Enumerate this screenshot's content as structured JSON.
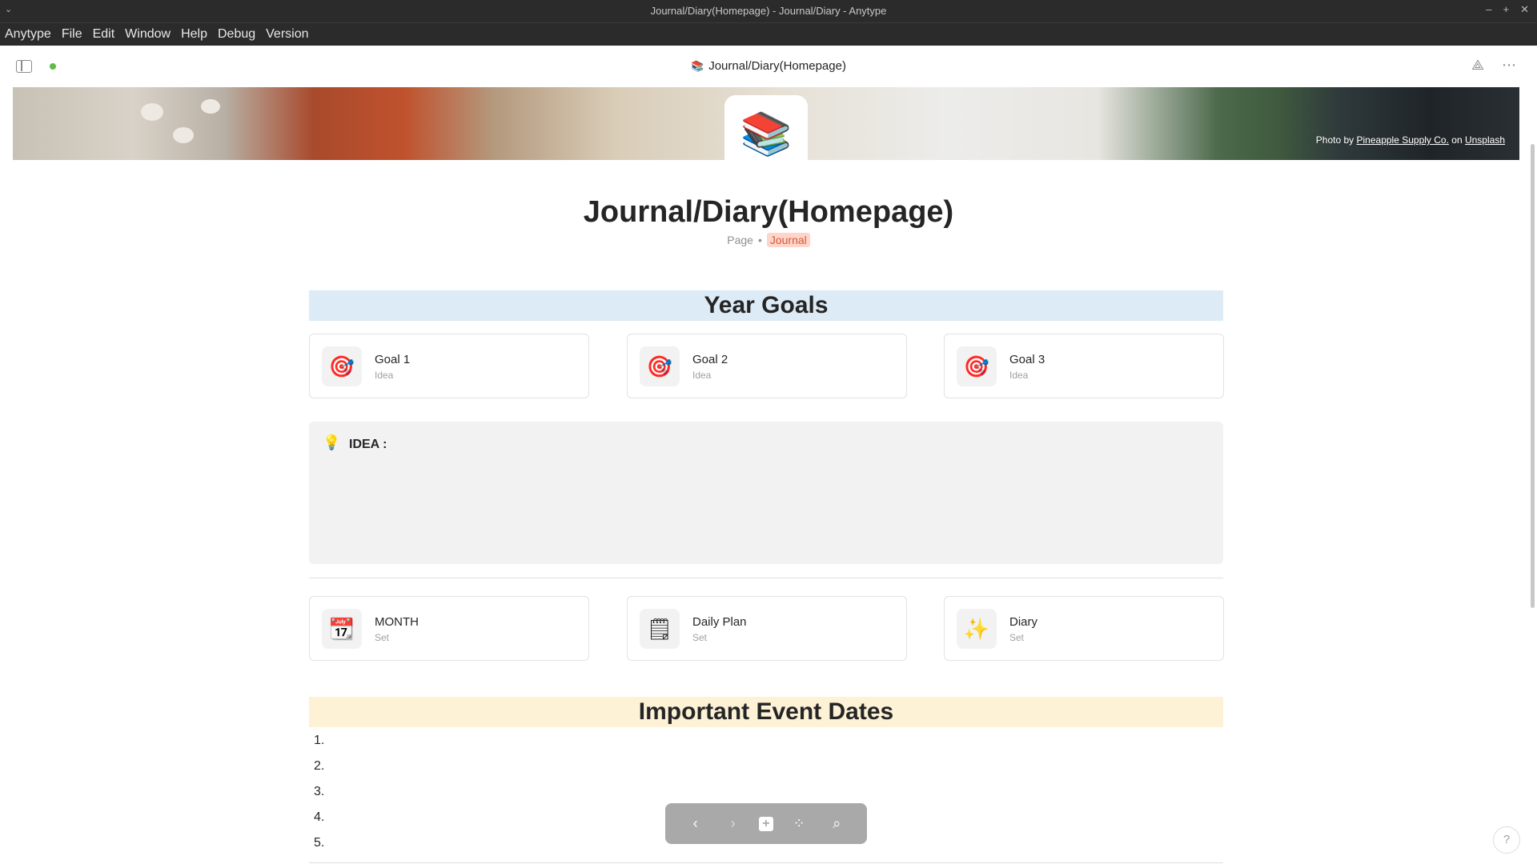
{
  "window": {
    "title": "Journal/Diary(Homepage) - Journal/Diary - Anytype",
    "controls": [
      "–",
      "+",
      "✕"
    ]
  },
  "menu": [
    "Anytype",
    "File",
    "Edit",
    "Window",
    "Help",
    "Debug",
    "Version"
  ],
  "header": {
    "page_icon": "📚",
    "title": "Journal/Diary(Homepage)",
    "right_icons": [
      "share-icon",
      "more-icon"
    ]
  },
  "cover": {
    "credit_prefix": "Photo by",
    "credit_author": "Pineapple Supply Co.",
    "credit_on": "on",
    "credit_site": "Unsplash"
  },
  "page": {
    "icon": "📚",
    "title": "Journal/Diary(Homepage)",
    "type": "Page",
    "tag": "Journal"
  },
  "year_goals": {
    "heading": "Year Goals",
    "cards": [
      {
        "icon": "🎯",
        "name": "Goal 1",
        "type": "Idea"
      },
      {
        "icon": "🎯",
        "name": "Goal 2",
        "type": "Idea"
      },
      {
        "icon": "🎯",
        "name": "Goal 3",
        "type": "Idea"
      }
    ]
  },
  "callout": {
    "icon": "💡",
    "text": "IDEA :"
  },
  "sets": [
    {
      "icon": "📆",
      "name": "MONTH",
      "type": "Set"
    },
    {
      "icon": "🗒",
      "name": "Daily Plan",
      "type": "Set"
    },
    {
      "icon": "✨",
      "name": "Diary",
      "type": "Set"
    }
  ],
  "events": {
    "heading": "Important Event Dates",
    "items": [
      "1.",
      "2.",
      "3.",
      "4.",
      "5."
    ]
  },
  "navbar": {
    "back": "‹",
    "forward": "›",
    "plus": "+",
    "graph": "⁘",
    "search": "⌕"
  },
  "help": "?"
}
